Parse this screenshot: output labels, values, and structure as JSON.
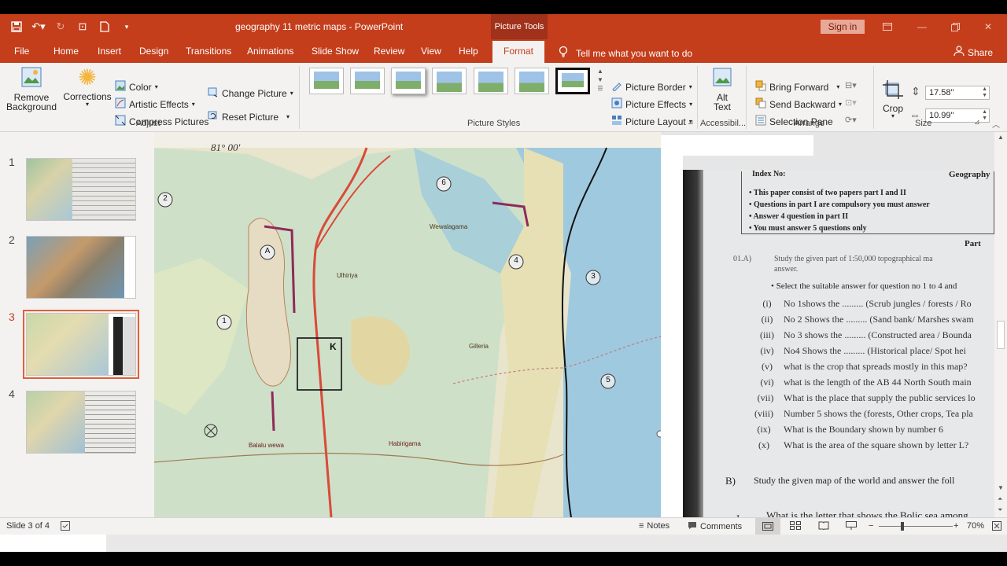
{
  "titlebar": {
    "document_title": "geography 11 metric maps  -  PowerPoint",
    "context_tab_title": "Picture Tools",
    "sign_in_label": "Sign in",
    "window_buttons": [
      "ribbon-display-icon",
      "minimize-icon",
      "restore-icon",
      "close-icon"
    ],
    "qat_icons": [
      "save-icon",
      "undo-icon",
      "redo-icon",
      "start-from-beginning-icon",
      "new-file-icon",
      "customize-qat-icon"
    ]
  },
  "tabs": [
    "File",
    "Home",
    "Insert",
    "Design",
    "Transitions",
    "Animations",
    "Slide Show",
    "Review",
    "View",
    "Help",
    "Format"
  ],
  "active_tab": "Format",
  "tell_me": "Tell me what you want to do",
  "share_label": "Share",
  "ribbon": {
    "adjust": {
      "remove_background": [
        "Remove",
        "Background"
      ],
      "corrections": "Corrections",
      "color": "Color",
      "artistic_effects": "Artistic Effects",
      "compress_pictures": "Compress Pictures",
      "change_picture": "Change Picture",
      "reset_picture": "Reset Picture",
      "label": "Adjust"
    },
    "picture_styles": {
      "picture_border": "Picture Border",
      "picture_effects": "Picture Effects",
      "picture_layout": "Picture Layout",
      "label": "Picture Styles",
      "thumb_count": 7
    },
    "accessibility": {
      "alt_text": [
        "Alt",
        "Text"
      ],
      "label": "Accessibil..."
    },
    "arrange": {
      "bring_forward": "Bring Forward",
      "send_backward": "Send Backward",
      "selection_pane": "Selection Pane",
      "label": "Arrange"
    },
    "size": {
      "crop": "Crop",
      "height": "17.58\"",
      "width": "10.99\"",
      "label": "Size"
    }
  },
  "slides": [
    {
      "number": "1"
    },
    {
      "number": "2"
    },
    {
      "number": "3"
    },
    {
      "number": "4"
    }
  ],
  "active_slide": "3",
  "map": {
    "longitude": "81° 00'",
    "square_letter": "K",
    "markers": [
      "1",
      "2",
      "3",
      "4",
      "5",
      "6",
      "A"
    ],
    "place_names": [
      "Ulhiriya",
      "Wewalagama",
      "Balalu wewa",
      "Habirigama",
      "Gilleria"
    ]
  },
  "paper": {
    "index_no": "Index No:",
    "subject": "Geography",
    "instructions": [
      "This paper consist of two papers part I and II",
      "Questions in part I are compulsory you must answer",
      "Answer 4 question in part II",
      "You must answer 5 questions only"
    ],
    "part_label": "Part",
    "q1a_label": "01.A)",
    "q1a_text": "Study the given part of 1:50,000 topographical ma",
    "q1a_text2": "answer.",
    "select_line": "Select the suitable answer for question no 1 to 4 and",
    "questions": [
      [
        "(i)",
        "No 1shows the ......... (Scrub jungles / forests / Ro"
      ],
      [
        "(ii)",
        "No 2 Shows the ......... (Sand bank/ Marshes swam"
      ],
      [
        "(iii)",
        "No 3 shows the ......... (Constructed area / Bounda"
      ],
      [
        "(iv)",
        "No4 Shows the ......... (Historical place/ Spot hei"
      ],
      [
        "(v)",
        "what is the crop that spreads mostly in this map?"
      ],
      [
        "(vi)",
        "what is the length of the AB 44 North South main"
      ],
      [
        "(vii)",
        "What is the place that supply the public services lo"
      ],
      [
        "(viii)",
        "Number 5 shows the (forests, Other crops, Tea pla"
      ],
      [
        "(ix)",
        "What is the Boundary shown by number 6"
      ],
      [
        "(x)",
        "What is the area of the square shown by letter L?"
      ]
    ],
    "b_label": "B)",
    "b_text": "Study the given map of the world and answer the foll",
    "i_label": "I.",
    "i_text": "What is the letter that shows the Bolic sea among"
  },
  "statusbar": {
    "slide_info": "Slide 3 of 4",
    "notes": "Notes",
    "comments": "Comments",
    "zoom": "70%"
  }
}
